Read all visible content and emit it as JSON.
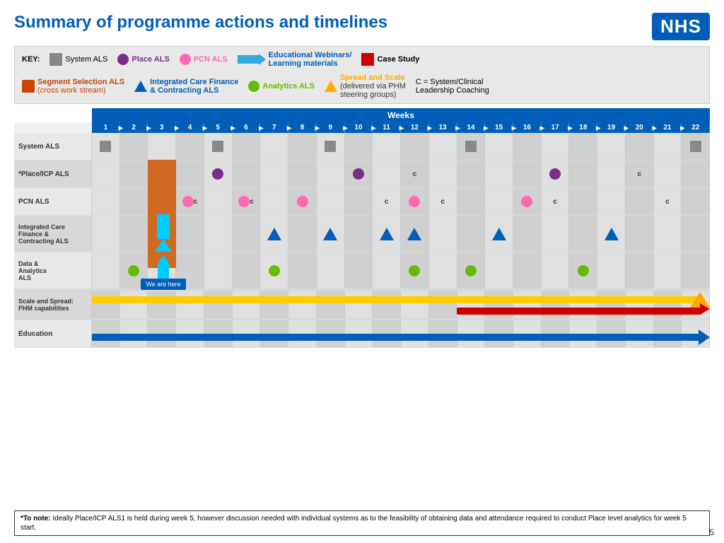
{
  "header": {
    "title": "Summary of programme actions and timelines",
    "nhs_logo": "NHS"
  },
  "key": {
    "label": "KEY:",
    "items": [
      {
        "id": "system-als",
        "shape": "grey-square",
        "text": "System ALS",
        "color": "#888888"
      },
      {
        "id": "place-als",
        "shape": "purple-circle",
        "text": "Place ALS",
        "color": "#7B2D8B"
      },
      {
        "id": "pcn-als",
        "shape": "pink-circle",
        "text": "PCN ALS",
        "color": "#FF69B4"
      },
      {
        "id": "edu-webinars",
        "shape": "blue-arrow",
        "text": "Educational Webinars/ Learning materials",
        "color": "#33AADD"
      },
      {
        "id": "case-study",
        "shape": "red-square",
        "text": "Case Study",
        "color": "#CC0000"
      },
      {
        "id": "segment-als",
        "shape": "orange-rect",
        "text": "Segment Selection ALS (cross work stream)",
        "color": "#CC4400"
      },
      {
        "id": "icf-als",
        "shape": "blue-triangle",
        "text": "Integrated Care Finance & Contracting ALS",
        "color": "#005EB8"
      },
      {
        "id": "analytics-als",
        "shape": "green-circle",
        "text": "Analytics ALS",
        "color": "#66BB00"
      },
      {
        "id": "spread-scale",
        "shape": "yellow-triangle",
        "text": "Spread and Scale (delivered via PHM steering groups)",
        "color": "#FFAA00"
      },
      {
        "id": "coaching",
        "shape": "none",
        "text": "C = System/Clinical Leadership Coaching",
        "color": "#333333"
      }
    ]
  },
  "weeks_header": "Weeks",
  "weeks": [
    1,
    2,
    3,
    4,
    5,
    6,
    7,
    8,
    9,
    10,
    11,
    12,
    13,
    14,
    15,
    16,
    17,
    18,
    19,
    20,
    21,
    22
  ],
  "rows": [
    {
      "label": "System ALS",
      "cells": {
        "1": "grey-square",
        "5": "grey-square",
        "9": "grey-square",
        "14": "grey-square",
        "22": "grey-square"
      }
    },
    {
      "label": "*Place/ICP ALS",
      "cells": {
        "5": "purple-circle",
        "10": "purple-circle",
        "12": "c",
        "17": "purple-circle",
        "20": "c"
      }
    },
    {
      "label": "PCN ALS",
      "cells": {
        "4": "pink-circle",
        "4c": "c",
        "6": "pink-circle",
        "6c": "c",
        "8": "pink-circle",
        "11": "c",
        "12": "pink-circle",
        "13": "c",
        "16": "pink-circle",
        "17": "c",
        "21": "c"
      }
    },
    {
      "label": "Integrated Care Finance & Contracting ALS",
      "cells": {
        "7": "blue-triangle",
        "9": "blue-triangle",
        "11": "blue-triangle",
        "12": "blue-triangle",
        "15": "blue-triangle",
        "19": "blue-triangle"
      }
    },
    {
      "label": "Data & Analytics ALS",
      "cells": {
        "2": "green-circle",
        "7": "green-circle",
        "12": "green-circle",
        "14": "green-circle",
        "18": "green-circle"
      },
      "we_are_here": true,
      "we_are_here_col": 3
    },
    {
      "label": "Scale and Spread: PHM capabilities",
      "type": "bars"
    },
    {
      "label": "Education",
      "type": "bar-education"
    }
  ],
  "footnote": "*To note: Ideally Place/ICP ALS1 is held during week 5, however discussion needed with individual systems as to the feasibility of obtaining data and attendance required to conduct Place level analytics for week 5 start.",
  "page_number": "5",
  "we_are_here_text": "We are here"
}
